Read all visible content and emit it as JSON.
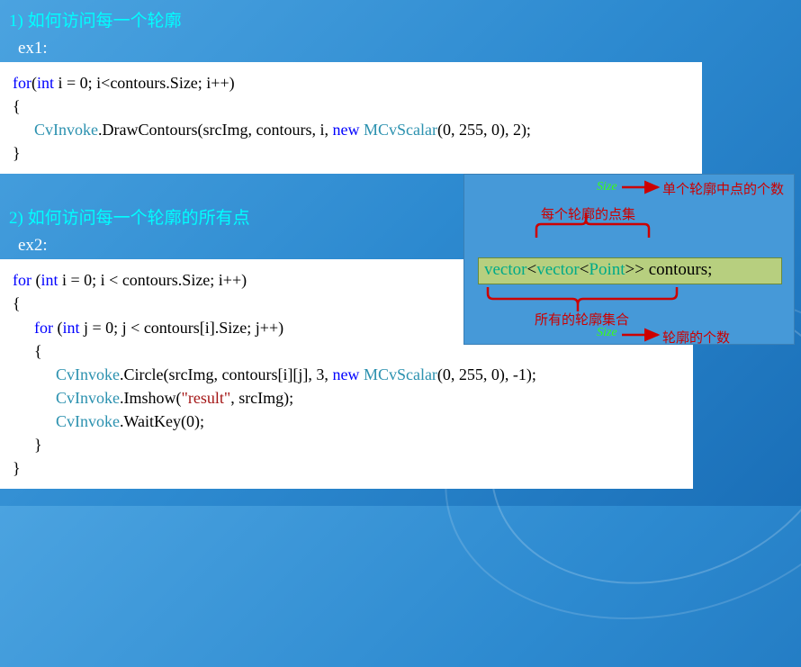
{
  "heading1": "1) 如何访问每一个轮廓",
  "ex1_label": "ex1:",
  "code1": {
    "for": "for",
    "int": "int",
    "line1_rest": " i = 0; i<contours.Size; i++)",
    "brace_open": "{",
    "cvInvoke1": "CvInvoke",
    "drawPart1": ".DrawContours(srcImg, contours, i, ",
    "new": "new",
    "mcvs1": " MCvScalar",
    "drawPart2": "(0, 255, 0), 2);",
    "brace_close": "}"
  },
  "heading2": "2) 如何访问每一个轮廓的所有点",
  "ex2_label": "ex2:",
  "code2": {
    "for": "for",
    "int": "int",
    "loop1_rest": " i = 0; i < contours.Size; i++)",
    "brace_open": "{",
    "loop2_rest": " j = 0; j < contours[i].Size; j++)",
    "cvInvoke": "CvInvoke",
    "circle_part1": ".Circle(srcImg, contours[i][j], 3, ",
    "new": "new",
    "mcvs": " MCvScalar",
    "circle_part2": "(0, 255, 0), -1);",
    "imshow_part1": ".Imshow(",
    "result_str": "\"result\"",
    "imshow_part2": ", srcImg);",
    "waitkey": ".WaitKey(0);",
    "brace_close": "}"
  },
  "diagram": {
    "vector1": "vector",
    "lt1": "<",
    "vector2": "vector",
    "lt2": "<",
    "point": "Point",
    "gtgt": ">>",
    "contours": " contours;",
    "annot_single_points": "单个轮廓中点的个数",
    "annot_each_pointset": "每个轮廓的点集",
    "annot_all_contours": "所有的轮廓集合",
    "annot_contour_count": "轮廓的个数",
    "size_top": "Size",
    "size_bottom": "Size"
  }
}
